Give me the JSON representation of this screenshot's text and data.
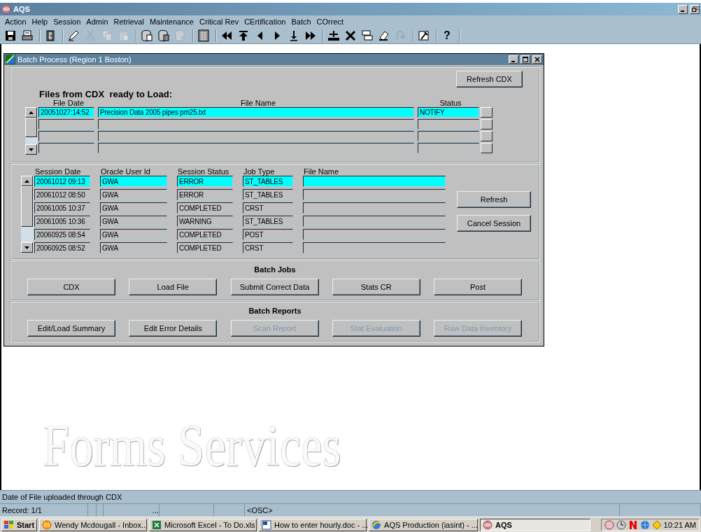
{
  "window": {
    "title": "AQS"
  },
  "menu": [
    "Action",
    "Help",
    "Session",
    "Admin",
    "Retrieval",
    "Maintenance",
    "Critical Rev",
    "CErtification",
    "Batch",
    "COrrect"
  ],
  "toolbar": [
    [
      {
        "kind": "save",
        "disabled": false
      },
      {
        "kind": "print",
        "disabled": false
      }
    ],
    [
      {
        "kind": "exit",
        "disabled": false
      }
    ],
    [
      {
        "kind": "edit",
        "disabled": false
      },
      {
        "kind": "cut",
        "disabled": true
      },
      {
        "kind": "copy",
        "disabled": true
      },
      {
        "kind": "paste",
        "disabled": true
      }
    ],
    [
      {
        "kind": "query",
        "disabled": false
      },
      {
        "kind": "execute",
        "disabled": false
      },
      {
        "kind": "cancel-query",
        "disabled": true
      }
    ],
    [
      {
        "kind": "grid",
        "disabled": false
      }
    ],
    [
      {
        "kind": "first",
        "disabled": false
      },
      {
        "kind": "top",
        "disabled": false
      },
      {
        "kind": "prev",
        "disabled": false
      },
      {
        "kind": "next",
        "disabled": false
      },
      {
        "kind": "down",
        "disabled": false
      },
      {
        "kind": "last",
        "disabled": false
      }
    ],
    [
      {
        "kind": "insert",
        "disabled": false
      },
      {
        "kind": "delete",
        "disabled": false
      },
      {
        "kind": "duplicate",
        "disabled": false
      },
      {
        "kind": "clear",
        "disabled": false
      },
      {
        "kind": "undo",
        "disabled": true
      }
    ],
    [
      {
        "kind": "tool",
        "disabled": false
      }
    ],
    [
      {
        "kind": "help",
        "label": "?",
        "disabled": false
      }
    ]
  ],
  "form": {
    "title": "Batch Process (Region 1 Boston)",
    "refresh_cdx": "Refresh CDX",
    "files": {
      "heading": "Files from CDX  ready to Load:",
      "columns": [
        "File Date",
        "File Name",
        "Status"
      ],
      "rows": [
        {
          "cells": [
            "20051027:14:52",
            "Precision Data 2005 pipes pm25.txt",
            "NOTIFY"
          ],
          "selected": true
        },
        {
          "cells": [],
          "selected": false
        },
        {
          "cells": [],
          "selected": false
        },
        {
          "cells": [],
          "selected": false
        }
      ]
    },
    "sessions": {
      "columns": [
        "Session Date",
        "Oracle User Id",
        "Session Status",
        "Job Type",
        "File Name"
      ],
      "rows": [
        {
          "cells": [
            "20061012 09:13",
            "GWA",
            "ERROR",
            "ST_TABLES"
          ],
          "selected": true
        },
        {
          "cells": [
            "20061012 08:50",
            "GWA",
            "ERROR",
            "ST_TABLES"
          ],
          "selected": false
        },
        {
          "cells": [
            "20061005 10:37",
            "GWA",
            "COMPLETED",
            "CRST"
          ],
          "selected": false
        },
        {
          "cells": [
            "20061005 10:36",
            "GWA",
            "WARNING",
            "ST_TABLES"
          ],
          "selected": false
        },
        {
          "cells": [
            "20060925 08:54",
            "GWA",
            "COMPLETED",
            "POST"
          ],
          "selected": false
        },
        {
          "cells": [
            "20060925 08:52",
            "GWA",
            "COMPLETED",
            "CRST"
          ],
          "selected": false
        }
      ],
      "buttons": [
        "Refresh",
        "Cancel Session"
      ]
    },
    "batch_jobs": {
      "title": "Batch Jobs",
      "buttons": [
        {
          "label": "CDX",
          "disabled": false
        },
        {
          "label": "Load File",
          "disabled": false
        },
        {
          "label": "Submit Correct Data",
          "disabled": false
        },
        {
          "label": "Stats CR",
          "disabled": false
        },
        {
          "label": "Post",
          "disabled": false
        }
      ]
    },
    "batch_reports": {
      "title": "Batch Reports",
      "buttons": [
        {
          "label": "Edit/Load Summary",
          "disabled": false
        },
        {
          "label": "Edit Error Details",
          "disabled": false
        },
        {
          "label": "Scan Report",
          "disabled": true
        },
        {
          "label": "Stat Evaluation",
          "disabled": true
        },
        {
          "label": "Raw Data Inventory",
          "disabled": true
        }
      ]
    }
  },
  "background_text": "Forms Services",
  "status_bar": {
    "hint": "Date of File uploaded through CDX",
    "record": "Record: 1/1",
    "ellipsis": "...",
    "mode": "<OSC>"
  },
  "taskbar": {
    "start": "Start",
    "tasks": [
      {
        "label": "Wendy Mcdougall - Inbox...",
        "kind": "mail",
        "selected": false
      },
      {
        "label": "Microsoft Excel - To Do.xls",
        "kind": "excel",
        "selected": false
      },
      {
        "label": "How to enter hourly.doc - ...",
        "kind": "word",
        "selected": false
      },
      {
        "label": "AQS Production (iasint) - ...",
        "kind": "browser",
        "selected": false
      },
      {
        "label": "AQS",
        "kind": "app",
        "selected": true
      }
    ],
    "clock": "10:21 AM"
  }
}
